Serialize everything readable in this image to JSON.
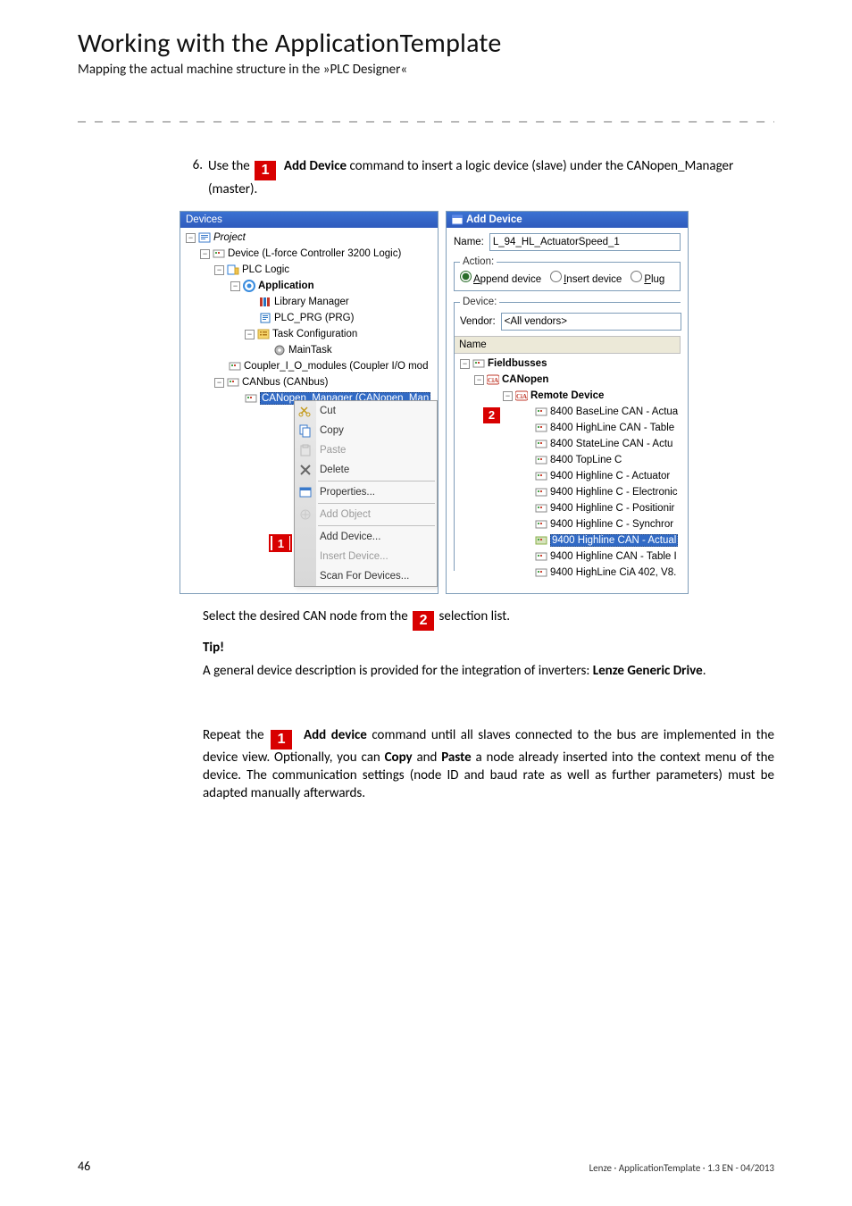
{
  "header": {
    "title": "Working with the ApplicationTemplate",
    "subtitle": "Mapping the actual machine structure in the »PLC Designer«",
    "dashline": "_ _ _ _ _ _ _ _ _ _ _ _ _ _ _ _ _ _ _ _ _ _ _ _ _ _ _ _ _ _ _ _ _ _ _ _ _ _ _ _ _ _ _ _ _ _ _ _ _ _ _ _ _ _ _ _ _ _ _ _ _ _ _ _"
  },
  "step6": {
    "number": "6.",
    "pre": "Use the ",
    "bold": "Add Device",
    "post": " command to insert a logic device (slave) under the CANopen_Manager (master)."
  },
  "devices_panel": {
    "title": "Devices",
    "tree": {
      "project": "Project",
      "device": "Device (L-force Controller 3200 Logic)",
      "plc_logic": "PLC Logic",
      "application": "Application",
      "library_manager": "Library Manager",
      "plc_prg": "PLC_PRG (PRG)",
      "task_cfg": "Task Configuration",
      "maintask": "MainTask",
      "coupler": "Coupler_I_O_modules (Coupler I/O mod",
      "canbus": "CANbus (CANbus)",
      "canopen_mgr": "CANopen_Manager (CANopen_Man"
    },
    "menu": {
      "cut": "Cut",
      "copy": "Copy",
      "paste": "Paste",
      "delete": "Delete",
      "properties": "Properties...",
      "add_object": "Add Object",
      "add_device": "Add Device...",
      "insert_device": "Insert Device...",
      "scan": "Scan For Devices..."
    }
  },
  "add_device": {
    "title": "Add Device",
    "name_label": "Name:",
    "name_value": "L_94_HL_ActuatorSpeed_1",
    "action_legend": "Action:",
    "radio_append": {
      "a": "A",
      "ppend": "ppend device"
    },
    "radio_insert": {
      "i": "I",
      "nsert": "nsert device"
    },
    "radio_plug": {
      "p": "P",
      "lug": "lug"
    },
    "device_legend": "Device:",
    "vendor_label": "Vendor:",
    "vendor_value": "<All vendors>",
    "col_name": "Name",
    "tree": {
      "fieldbusses": "Fieldbusses",
      "canopen": "CANopen",
      "remote_device": "Remote Device",
      "items": [
        "8400 BaseLine CAN - Actua",
        "8400 HighLine CAN - Table",
        "8400 StateLine CAN - Actu",
        "8400 TopLine C",
        "9400 Highline C - Actuator",
        "9400 Highline C - Electronic",
        "9400 Highline C - Positionir",
        "9400 Highline C - Synchror",
        "9400 Highline CAN - Actual",
        "9400 Highline CAN - Table I",
        "9400 HighLine CiA 402, V8."
      ]
    },
    "selected_index": 8
  },
  "after_fig": {
    "select_line_pre": "Select the desired CAN node from the ",
    "select_line_post": " selection list.",
    "tip": "Tip!",
    "tip_text_pre": "A general device description is provided for the integration of inverters: ",
    "tip_text_bold": "Lenze Generic Drive",
    "tip_text_post": ".",
    "repeat_pre": "Repeat the ",
    "repeat_bold": "Add device",
    "repeat_mid": " command until all slaves connected to the bus are implemented in the device view. Optionally, you can ",
    "copy": "Copy",
    "and": " and ",
    "paste": "Paste",
    "repeat_post": " a node already inserted into the context menu of the device. The communication settings (node ID and baud rate as well as further parameters) must be adapted manually afterwards."
  },
  "footer": {
    "page": "46",
    "doc": "Lenze · ApplicationTemplate · 1.3 EN - 04/2013"
  },
  "callouts": {
    "c1": "1",
    "c2": "2"
  }
}
